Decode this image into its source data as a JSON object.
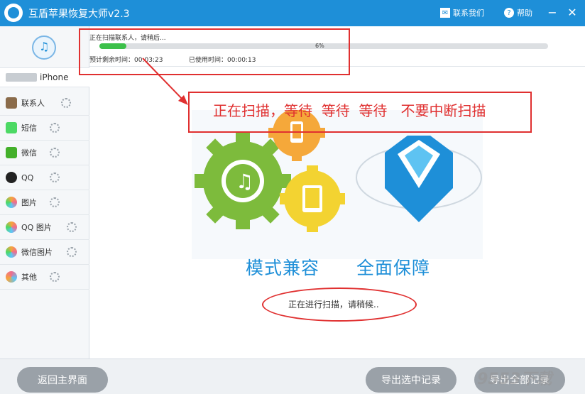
{
  "titlebar": {
    "title": "互盾苹果恢复大师v2.3",
    "contact": "联系我们",
    "help": "帮助",
    "contact_icon": "chat-icon",
    "help_icon": "question-icon"
  },
  "device": {
    "name": "iPhone",
    "icon": "itunes-disc-icon"
  },
  "sidebar": {
    "items": [
      {
        "label": "联系人",
        "icon": "contacts-icon",
        "color": "#8a6b4a"
      },
      {
        "label": "短信",
        "icon": "sms-icon",
        "color": "#4cd964"
      },
      {
        "label": "微信",
        "icon": "wechat-icon",
        "color": "#43b02a"
      },
      {
        "label": "QQ",
        "icon": "qq-icon",
        "color": "#222222"
      },
      {
        "label": "图片",
        "icon": "photos-icon",
        "color": "#f7a53b"
      },
      {
        "label": "QQ 图片",
        "icon": "qq-photos-icon",
        "color": "#f7a53b"
      },
      {
        "label": "微信图片",
        "icon": "wechat-photos-icon",
        "color": "#43b02a"
      },
      {
        "label": "其他",
        "icon": "other-icon",
        "color": "#f06c8e"
      }
    ]
  },
  "scan": {
    "status": "正在扫描联系人，请稍后...",
    "percent_label": "6%",
    "progress": 0.06,
    "remaining": "预计剩余时间：00:03:23",
    "used": "已使用时间：00:00:13"
  },
  "main": {
    "warning": "正在扫描，等待  等待  等待   不要中断扫描",
    "slogan_left": "模式兼容",
    "slogan_right": "全面保障",
    "scanning_text": "正在进行扫描，请稍候.."
  },
  "footer": {
    "back": "返回主界面",
    "export_selected": "导出选中记录",
    "export_all": "导出全部记录"
  },
  "watermark": "9553下载",
  "colors": {
    "titlebar": "#1e8fd8",
    "accent": "#1e8fd8",
    "progress": "#3cc04a",
    "annotation": "#e03030"
  }
}
